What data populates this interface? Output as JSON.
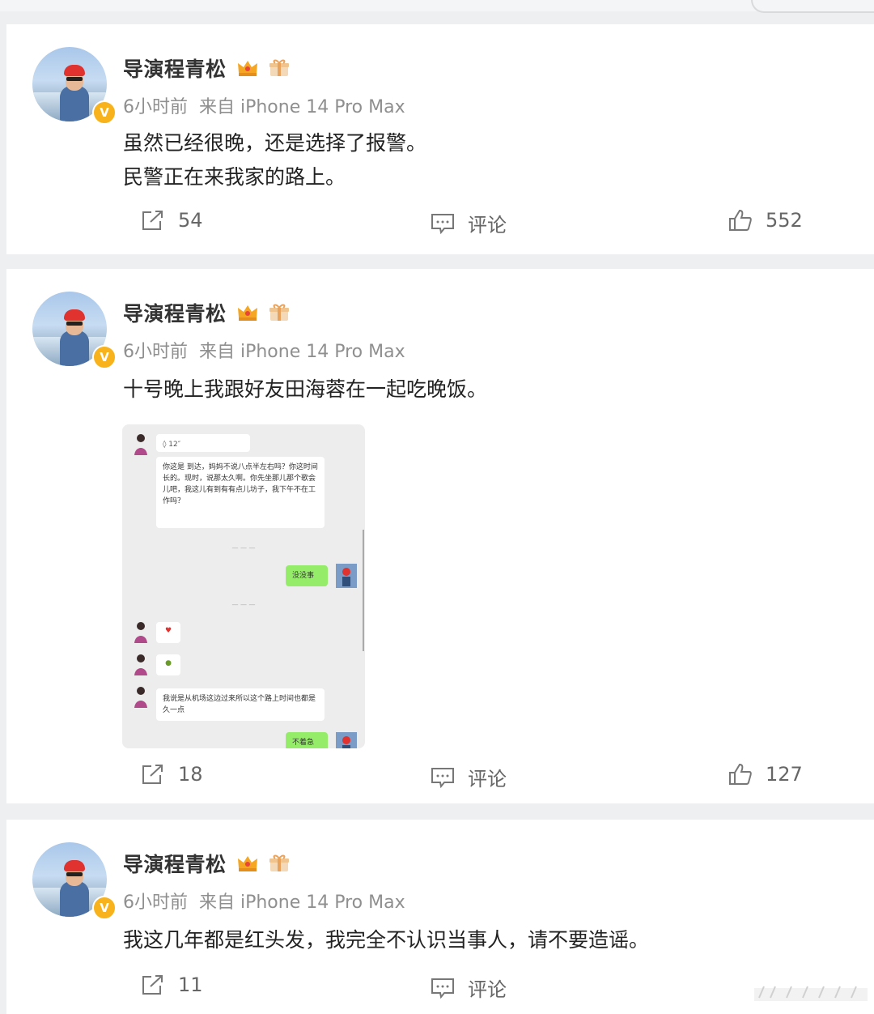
{
  "posts": [
    {
      "author": "导演程青松",
      "meta": "6小时前  来自 iPhone 14 Pro Max",
      "lines": [
        "虽然已经很晚，还是选择了报警。",
        "民警正在来我家的路上。"
      ],
      "repost_count": "54",
      "comment_label": "评论",
      "like_count": "552"
    },
    {
      "author": "导演程青松",
      "meta": "6小时前  来自 iPhone 14 Pro Max",
      "lines": [
        "十号晚上我跟好友田海蓉在一起吃晚饭。"
      ],
      "repost_count": "18",
      "comment_label": "评论",
      "like_count": "127",
      "chat": {
        "msg1": "你这是 到达，妈妈不说八点半左右吗？你这时间长的。现时，说那太久啊。你先坐那儿那个歌会儿吧，我这儿有到有有点儿坊子，我下午不在工作吗？",
        "reply1": "没没事",
        "msg2": "我说是从机场这边过来所以这个路上时间也都是久一点",
        "reply2": "不着急"
      }
    },
    {
      "author": "导演程青松",
      "meta": "6小时前  来自 iPhone 14 Pro Max",
      "lines": [
        "我这几年都是红头发，我完全不认识当事人，请不要造谣。"
      ],
      "repost_count": "11",
      "comment_label": "评论"
    }
  ],
  "colors": {
    "badge": "#f7b21c",
    "text": "#222222",
    "meta": "#8f8f8f",
    "bubble_green": "#95ec69"
  }
}
